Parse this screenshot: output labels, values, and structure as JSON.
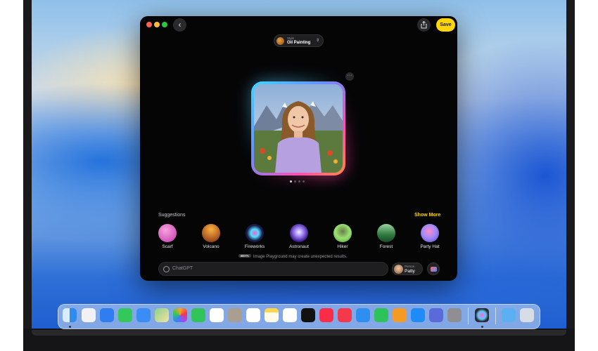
{
  "window": {
    "save_label": "Save",
    "back_glyph": "‹",
    "more_glyph": "···"
  },
  "style_picker": {
    "caption": "Style",
    "value": "Oil Painting",
    "chevron": "⌃"
  },
  "suggestions": {
    "title": "Suggestions",
    "show_more": "Show More",
    "items": [
      {
        "label": "Scarf",
        "icon": "scarf-icon",
        "color": "#e85cc6"
      },
      {
        "label": "Volcano",
        "icon": "volcano-icon",
        "color": "#d9582a"
      },
      {
        "label": "Fireworks",
        "icon": "fireworks-icon",
        "color": "#2a2a6a"
      },
      {
        "label": "Astronaut",
        "icon": "astronaut-icon",
        "color": "#6a3ad9"
      },
      {
        "label": "Hiker",
        "icon": "hiker-icon",
        "color": "#7ad05a"
      },
      {
        "label": "Forest",
        "icon": "forest-icon",
        "color": "#2e8a4a"
      },
      {
        "label": "Party Hat",
        "icon": "party-hat-icon",
        "color": "#8a6af0"
      }
    ]
  },
  "notice": {
    "badge": "BETA",
    "text": "Image Playground may create unexpected results."
  },
  "prompt": {
    "placeholder": "ChatGPT"
  },
  "person": {
    "caption": "Person",
    "name": "Patty"
  },
  "dock": {
    "apps": [
      {
        "name": "finder-icon",
        "color": "#3b8df0",
        "dot": true
      },
      {
        "name": "launchpad-icon",
        "color": "#f2f2f5",
        "dot": false
      },
      {
        "name": "safari-icon",
        "color": "#2f7df0",
        "dot": false
      },
      {
        "name": "messages-icon",
        "color": "#34c759",
        "dot": false
      },
      {
        "name": "mail-icon",
        "color": "#3a8df5",
        "dot": false
      },
      {
        "name": "maps-icon",
        "color": "#5ec26a",
        "dot": false
      },
      {
        "name": "photos-icon",
        "color": "#f5a623",
        "dot": false
      },
      {
        "name": "facetime-icon",
        "color": "#30c45a",
        "dot": false
      },
      {
        "name": "calendar-icon",
        "color": "#ffffff",
        "dot": false
      },
      {
        "name": "contacts-icon",
        "color": "#a89f92",
        "dot": false
      },
      {
        "name": "reminders-icon",
        "color": "#ffffff",
        "dot": false
      },
      {
        "name": "notes-icon",
        "color": "#ffd54a",
        "dot": false
      },
      {
        "name": "freeform-icon",
        "color": "#ffffff",
        "dot": false
      },
      {
        "name": "tv-icon",
        "color": "#111111",
        "dot": false
      },
      {
        "name": "music-icon",
        "color": "#fa2d48",
        "dot": false
      },
      {
        "name": "news-icon",
        "color": "#f5394a",
        "dot": false
      },
      {
        "name": "keynote-icon",
        "color": "#2f8ff0",
        "dot": false
      },
      {
        "name": "numbers-icon",
        "color": "#2ec35a",
        "dot": false
      },
      {
        "name": "pages-icon",
        "color": "#f59a23",
        "dot": false
      },
      {
        "name": "app-store-icon",
        "color": "#1f8cf5",
        "dot": false
      },
      {
        "name": "iphone-mirroring-icon",
        "color": "#5a6ad9",
        "dot": false
      },
      {
        "name": "system-settings-icon",
        "color": "#8e8e93",
        "dot": false
      },
      {
        "name": "image-playground-icon",
        "color": "#2a2a30",
        "dot": true
      },
      {
        "name": "downloads-folder-icon",
        "color": "#5ab0f0",
        "dot": false
      },
      {
        "name": "trash-icon",
        "color": "#d8dde5",
        "dot": false
      }
    ]
  }
}
